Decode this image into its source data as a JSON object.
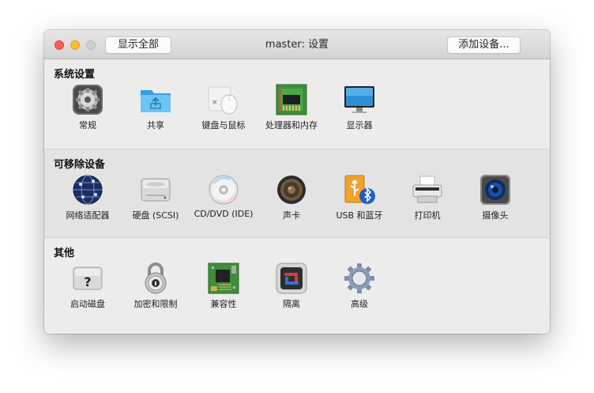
{
  "window": {
    "title": "master: 设置",
    "show_all_label": "显示全部",
    "add_device_label": "添加设备..."
  },
  "sections": [
    {
      "title": "系统设置",
      "items": [
        {
          "label": "常规",
          "icon": "general-icon"
        },
        {
          "label": "共享",
          "icon": "shared-folder-icon"
        },
        {
          "label": "键盘与鼠标",
          "icon": "keyboard-mouse-icon"
        },
        {
          "label": "处理器和内存",
          "icon": "cpu-memory-icon"
        },
        {
          "label": "显示器",
          "icon": "display-icon"
        }
      ]
    },
    {
      "title": "可移除设备",
      "items": [
        {
          "label": "网络适配器",
          "icon": "network-globe-icon"
        },
        {
          "label": "硬盘 (SCSI)",
          "icon": "hard-disk-icon"
        },
        {
          "label": "CD/DVD (IDE)",
          "icon": "cd-dvd-icon"
        },
        {
          "label": "声卡",
          "icon": "speaker-icon"
        },
        {
          "label": "USB 和蓝牙",
          "icon": "usb-bluetooth-icon"
        },
        {
          "label": "打印机",
          "icon": "printer-icon"
        },
        {
          "label": "摄像头",
          "icon": "camera-icon"
        }
      ]
    },
    {
      "title": "其他",
      "items": [
        {
          "label": "启动磁盘",
          "icon": "startup-disk-icon"
        },
        {
          "label": "加密和限制",
          "icon": "padlock-icon"
        },
        {
          "label": "兼容性",
          "icon": "circuit-board-icon"
        },
        {
          "label": "隔离",
          "icon": "isolation-icon"
        },
        {
          "label": "高级",
          "icon": "gear-icon"
        }
      ]
    }
  ]
}
